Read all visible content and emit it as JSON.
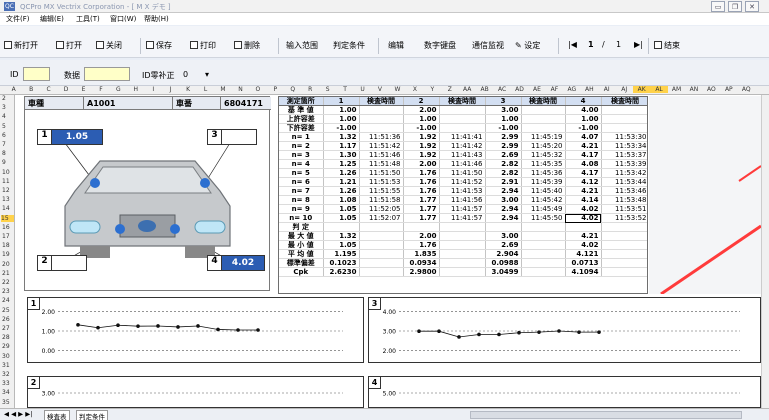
{
  "window": {
    "title": "QCPro MX  Vectrix Corporation - [ M X デモ ]",
    "minimize": "▭",
    "restore": "❐",
    "close": "✕"
  },
  "menu": [
    "文件(F)",
    "编辑(E)",
    "工具(T)",
    "窗口(W)",
    "帮助(H)"
  ],
  "toolbar": {
    "new_open": "新打开",
    "open": "打开",
    "close": "关闭",
    "save": "保存",
    "print": "打印",
    "delete": "删除",
    "input_range": "输入范围",
    "judge_cond": "判定条件",
    "edit": "编辑",
    "numkey": "数字键盘",
    "comm": "通信监视",
    "settings": "设定",
    "page_current": "1",
    "page_sep": "/",
    "page_total": "1",
    "end": "结束"
  },
  "idrow": {
    "id_label": "ID",
    "data_label": "数据",
    "zero_label": "ID零补正",
    "zero_value": "0"
  },
  "column_headers": [
    "A",
    "B",
    "C",
    "D",
    "E",
    "F",
    "G",
    "H",
    "I",
    "J",
    "K",
    "L",
    "M",
    "N",
    "O",
    "P",
    "Q",
    "R",
    "S",
    "T",
    "U",
    "V",
    "W",
    "X",
    "Y",
    "Z",
    "AA",
    "AB",
    "AC",
    "AD",
    "AE",
    "AF",
    "AG",
    "AH",
    "AI",
    "AJ",
    "AK",
    "AL",
    "AM",
    "AN",
    "AO",
    "AP",
    "AQ"
  ],
  "rows": [
    "2",
    "3",
    "4",
    "5",
    "6",
    "7",
    "8",
    "9",
    "10",
    "11",
    "12",
    "13",
    "14",
    "15",
    "16",
    "17",
    "18",
    "19",
    "20",
    "21",
    "22",
    "23",
    "24",
    "25",
    "26",
    "27",
    "28",
    "29",
    "30",
    "31",
    "32",
    "33",
    "34",
    "35"
  ],
  "car": {
    "type_label": "車種",
    "type_value": "A1001",
    "no_label": "車番",
    "no_value": "6804171",
    "points": [
      {
        "num": "1",
        "value": "1.05"
      },
      {
        "num": "3",
        "value": ""
      },
      {
        "num": "2",
        "value": ""
      },
      {
        "num": "4",
        "value": "4.02"
      }
    ]
  },
  "grid": {
    "header": [
      "測定箇所",
      "1",
      "検査時間",
      "2",
      "検査時間",
      "3",
      "検査時間",
      "4",
      "検査時間"
    ],
    "rows": [
      [
        "基 準 値",
        "1.00",
        "",
        "2.00",
        "",
        "3.00",
        "",
        "4.00",
        ""
      ],
      [
        "上許容差",
        "1.00",
        "",
        "1.00",
        "",
        "1.00",
        "",
        "1.00",
        ""
      ],
      [
        "下許容差",
        "-1.00",
        "",
        "-1.00",
        "",
        "-1.00",
        "",
        "-1.00",
        ""
      ],
      [
        "n=  1",
        "1.32",
        "11:51:36",
        "1.92",
        "11:41:41",
        "2.99",
        "11:45:19",
        "4.07",
        "11:53:30"
      ],
      [
        "n=  2",
        "1.17",
        "11:51:42",
        "1.92",
        "11:41:42",
        "2.99",
        "11:45:20",
        "4.21",
        "11:53:34"
      ],
      [
        "n=  3",
        "1.30",
        "11:51:46",
        "1.92",
        "11:41:43",
        "2.69",
        "11:45:32",
        "4.17",
        "11:53:37"
      ],
      [
        "n=  4",
        "1.25",
        "11:51:48",
        "2.00",
        "11:41:46",
        "2.82",
        "11:45:35",
        "4.08",
        "11:53:39"
      ],
      [
        "n=  5",
        "1.26",
        "11:51:50",
        "1.76",
        "11:41:50",
        "2.82",
        "11:45:36",
        "4.17",
        "11:53:42"
      ],
      [
        "n=  6",
        "1.21",
        "11:51:53",
        "1.76",
        "11:41:52",
        "2.91",
        "11:45:39",
        "4.12",
        "11:53:44"
      ],
      [
        "n=  7",
        "1.26",
        "11:51:55",
        "1.76",
        "11:41:53",
        "2.94",
        "11:45:40",
        "4.21",
        "11:53:46"
      ],
      [
        "n=  8",
        "1.08",
        "11:51:58",
        "1.77",
        "11:41:56",
        "3.00",
        "11:45:42",
        "4.14",
        "11:53:48"
      ],
      [
        "n=  9",
        "1.05",
        "11:52:05",
        "1.77",
        "11:41:57",
        "2.94",
        "11:45:49",
        "4.02",
        "11:53:51"
      ],
      [
        "n= 10",
        "1.05",
        "11:52:07",
        "1.77",
        "11:41:57",
        "2.94",
        "11:45:50",
        "4.02",
        "11:53:52"
      ],
      [
        "判  定",
        "",
        "",
        "",
        "",
        "",
        "",
        "",
        ""
      ],
      [
        "最 大 値",
        "1.32",
        "",
        "2.00",
        "",
        "3.00",
        "",
        "4.21",
        ""
      ],
      [
        "最 小 値",
        "1.05",
        "",
        "1.76",
        "",
        "2.69",
        "",
        "4.02",
        ""
      ],
      [
        "平 均 値",
        "1.195",
        "",
        "1.835",
        "",
        "2.904",
        "",
        "4.121",
        ""
      ],
      [
        "標準偏差",
        "0.1023",
        "",
        "0.0934",
        "",
        "0.0988",
        "",
        "0.0713",
        ""
      ],
      [
        "Cpk",
        "2.6230",
        "",
        "2.9800",
        "",
        "3.0499",
        "",
        "4.1094",
        ""
      ]
    ]
  },
  "chart_data": [
    {
      "type": "line",
      "num": "1",
      "yticks": [
        "2.00",
        "1.00",
        "0.00"
      ],
      "ylim": [
        -0.4,
        2.4
      ],
      "x": [
        1,
        2,
        3,
        4,
        5,
        6,
        7,
        8,
        9,
        10
      ],
      "values": [
        1.32,
        1.17,
        1.3,
        1.25,
        1.26,
        1.21,
        1.26,
        1.08,
        1.05,
        1.05
      ],
      "color": "#111111"
    },
    {
      "type": "line",
      "num": "3",
      "yticks": [
        "4.00",
        "3.00",
        "2.00"
      ],
      "ylim": [
        1.6,
        4.4
      ],
      "x": [
        1,
        2,
        3,
        4,
        5,
        6,
        7,
        8,
        9,
        10
      ],
      "values": [
        2.99,
        2.99,
        2.69,
        2.82,
        2.82,
        2.91,
        2.94,
        3.0,
        2.94,
        2.94
      ],
      "color": "#111111"
    },
    {
      "type": "line",
      "num": "2",
      "yticks": [
        "3.00"
      ],
      "ylim": [
        2.6,
        3.4
      ],
      "x": [],
      "values": [],
      "color": "#111111"
    },
    {
      "type": "line",
      "num": "4",
      "yticks": [
        "5.00"
      ],
      "ylim": [
        4.6,
        5.4
      ],
      "x": [],
      "values": [],
      "color": "#111111"
    }
  ],
  "sheet_tabs": {
    "nav": "◀ ◀ ▶ ▶|",
    "tab1": "検査表",
    "tab2": "判定条件"
  },
  "colors": {
    "accent": "#2c5db3",
    "highlight": "#ffd24a",
    "annotation": "#ff3b3b"
  }
}
